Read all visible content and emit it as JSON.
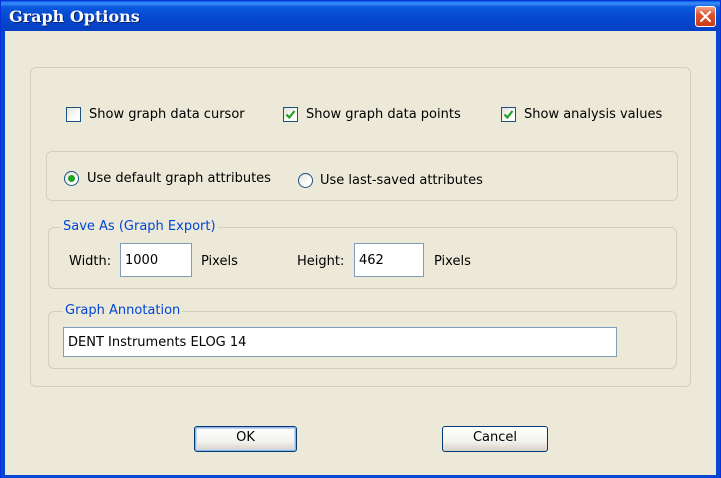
{
  "window": {
    "title": "Graph Options"
  },
  "options": {
    "show_cursor": {
      "label": "Show graph data cursor",
      "checked": false
    },
    "show_points": {
      "label": "Show graph data points",
      "checked": true
    },
    "show_analysis": {
      "label": "Show analysis values",
      "checked": true
    }
  },
  "attributes": {
    "use_default": {
      "label": "Use default graph attributes",
      "selected": true
    },
    "use_last_saved": {
      "label": "Use last-saved attributes",
      "selected": false
    }
  },
  "save_as": {
    "legend": "Save As (Graph Export)",
    "width_label": "Width:",
    "width_value": "1000",
    "width_unit": "Pixels",
    "height_label": "Height:",
    "height_value": "462",
    "height_unit": "Pixels"
  },
  "annotation": {
    "legend": "Graph Annotation",
    "value": "DENT Instruments ELOG 14"
  },
  "buttons": {
    "ok": "OK",
    "cancel": "Cancel"
  },
  "colors": {
    "title_bar": "#0447cf",
    "dialog_bg": "#ece9d8",
    "group_legend": "#0046d5",
    "radio_dot": "#21a121",
    "check_mark": "#21a121",
    "close_button": "#e2522e"
  },
  "icons": {
    "close": "close-x-icon",
    "check": "check-mark-icon"
  }
}
